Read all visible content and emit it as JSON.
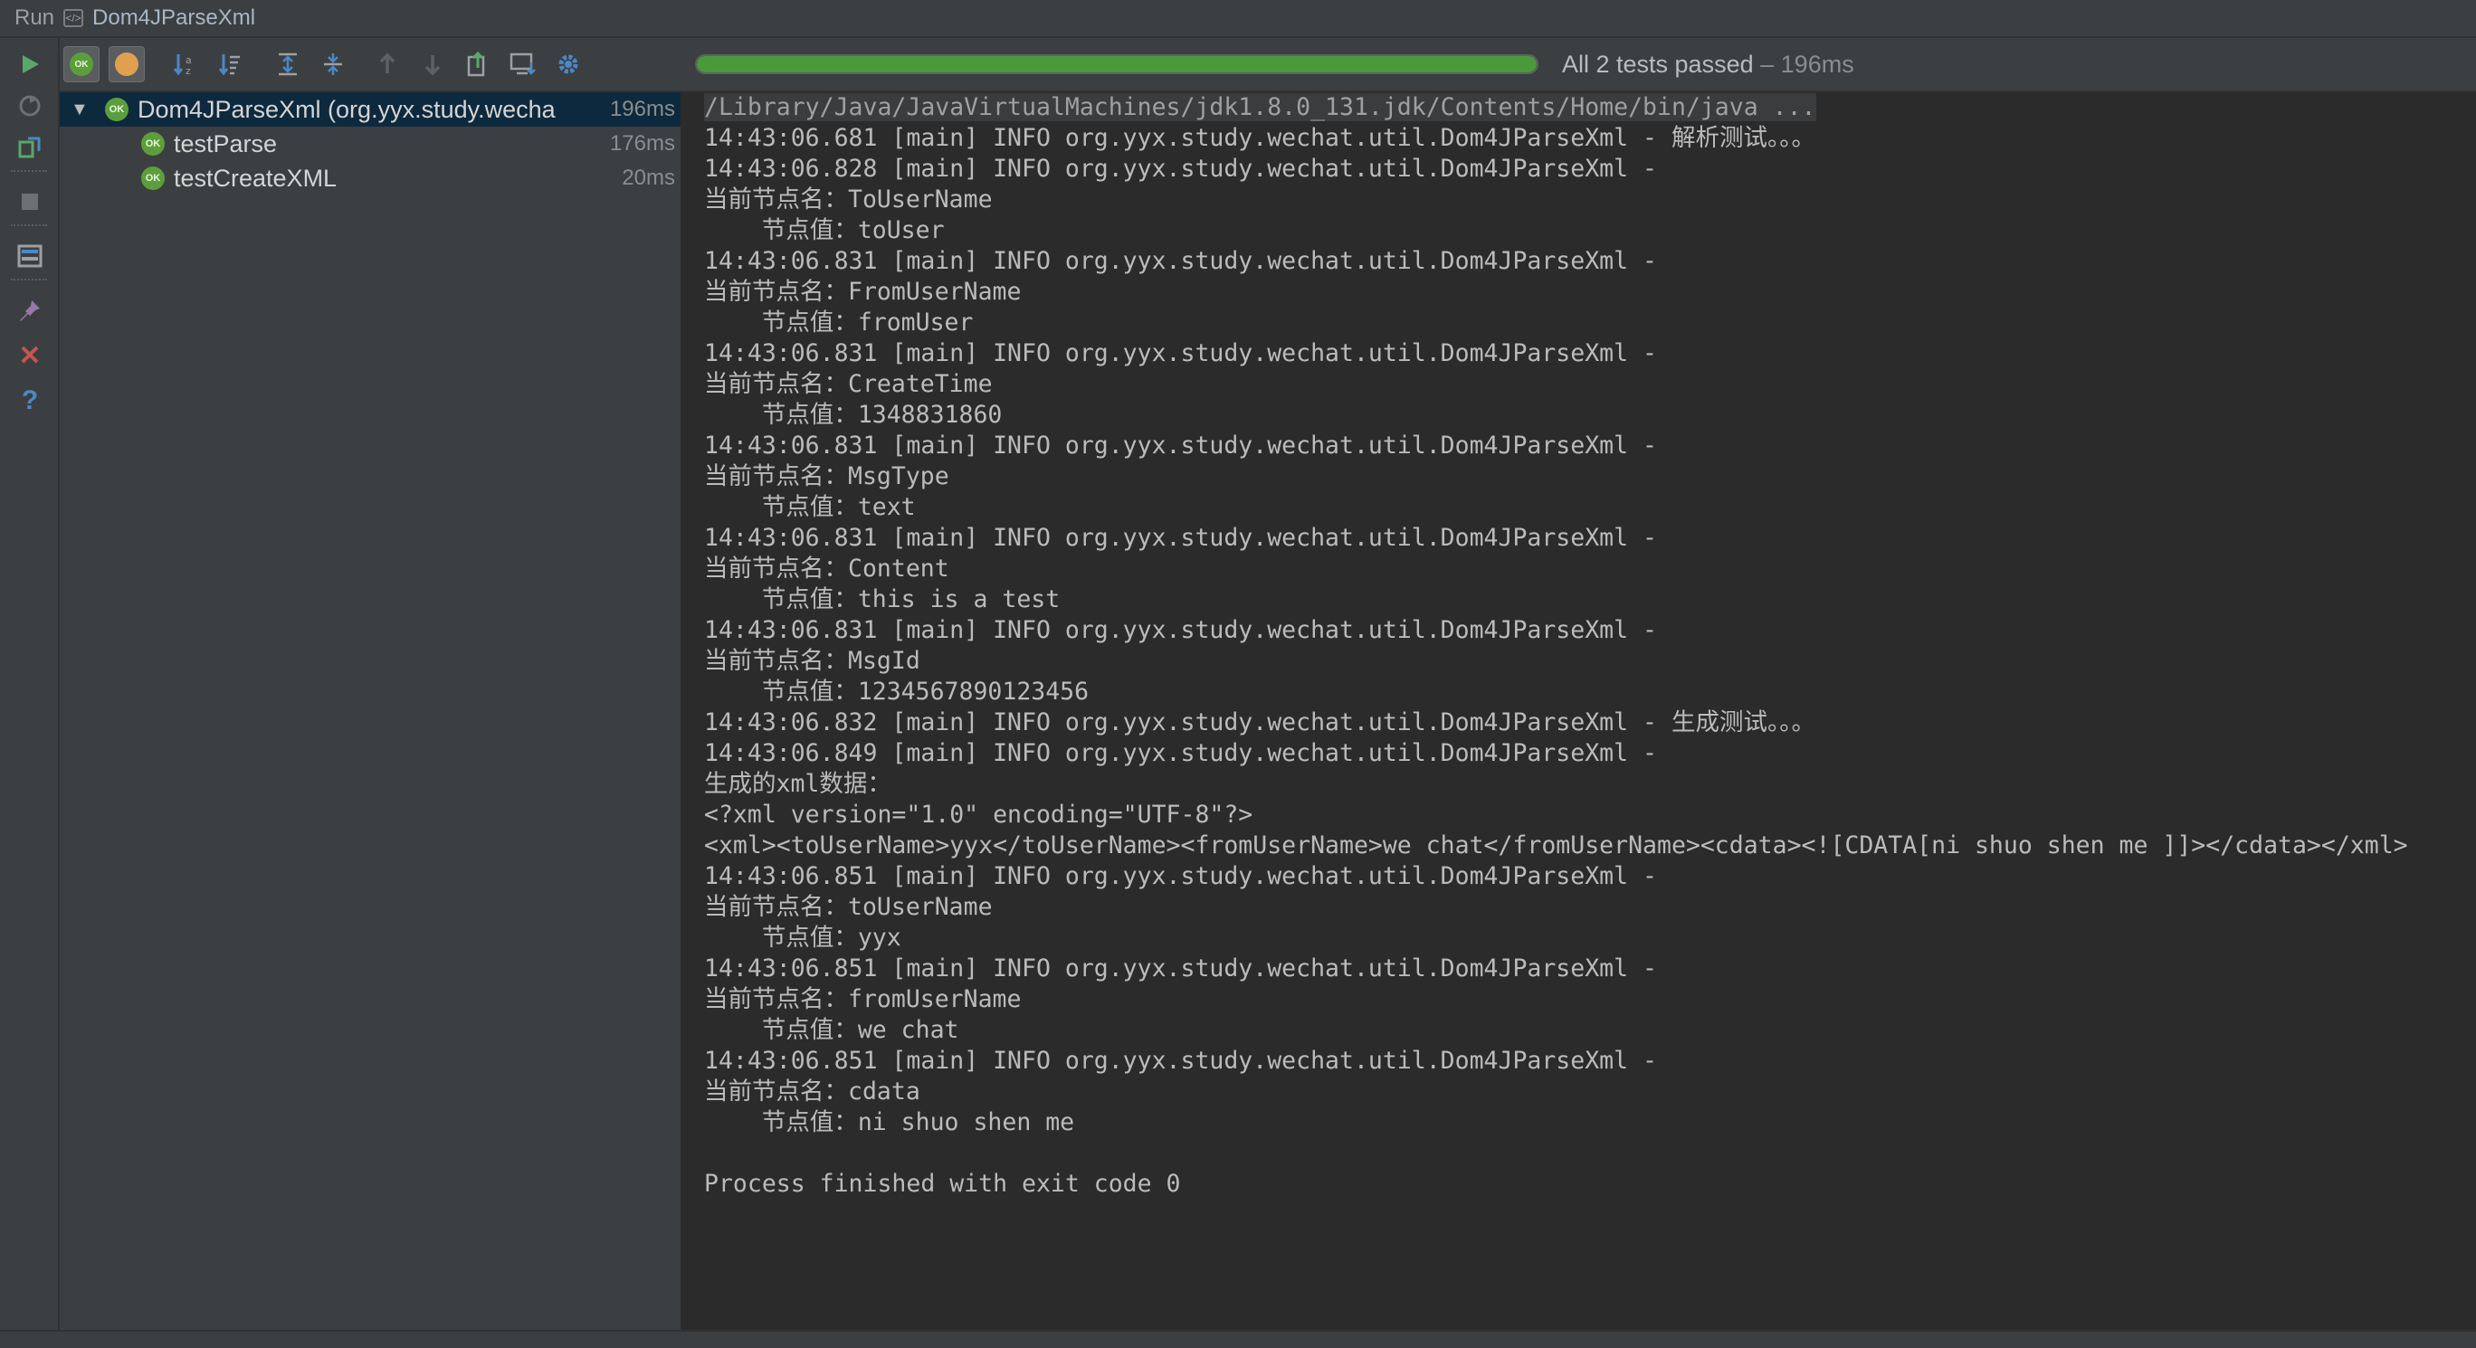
{
  "titlebar": {
    "prefix": "Run",
    "config_name": "Dom4JParseXml"
  },
  "toolbar": {
    "status_text": "All 2 tests passed",
    "status_duration": "– 196ms",
    "progress_fraction": 1.0,
    "colors": {
      "progress": "#4a9a3a",
      "passed": "#5c9f3a"
    }
  },
  "tree": {
    "root": {
      "label": "Dom4JParseXml (org.yyx.study.wecha",
      "time": "196ms",
      "badge": "OK"
    },
    "children": [
      {
        "label": "testParse",
        "time": "176ms",
        "badge": "OK"
      },
      {
        "label": "testCreateXML",
        "time": "20ms",
        "badge": "OK"
      }
    ]
  },
  "console": {
    "lines": [
      "/Library/Java/JavaVirtualMachines/jdk1.8.0_131.jdk/Contents/Home/bin/java ...",
      "14:43:06.681 [main] INFO org.yyx.study.wechat.util.Dom4JParseXml - 解析测试。。。",
      "14:43:06.828 [main] INFO org.yyx.study.wechat.util.Dom4JParseXml -",
      "当前节点名：ToUserName",
      "    节点值：toUser",
      "14:43:06.831 [main] INFO org.yyx.study.wechat.util.Dom4JParseXml -",
      "当前节点名：FromUserName",
      "    节点值：fromUser",
      "14:43:06.831 [main] INFO org.yyx.study.wechat.util.Dom4JParseXml -",
      "当前节点名：CreateTime",
      "    节点值：1348831860",
      "14:43:06.831 [main] INFO org.yyx.study.wechat.util.Dom4JParseXml -",
      "当前节点名：MsgType",
      "    节点值：text",
      "14:43:06.831 [main] INFO org.yyx.study.wechat.util.Dom4JParseXml -",
      "当前节点名：Content",
      "    节点值：this is a test",
      "14:43:06.831 [main] INFO org.yyx.study.wechat.util.Dom4JParseXml -",
      "当前节点名：MsgId",
      "    节点值：1234567890123456",
      "14:43:06.832 [main] INFO org.yyx.study.wechat.util.Dom4JParseXml - 生成测试。。。",
      "14:43:06.849 [main] INFO org.yyx.study.wechat.util.Dom4JParseXml -",
      "生成的xml数据：",
      "<?xml version=\"1.0\" encoding=\"UTF-8\"?>",
      "<xml><toUserName>yyx</toUserName><fromUserName>we chat</fromUserName><cdata><![CDATA[ni shuo shen me ]]></cdata></xml>",
      "14:43:06.851 [main] INFO org.yyx.study.wechat.util.Dom4JParseXml -",
      "当前节点名：toUserName",
      "    节点值：yyx",
      "14:43:06.851 [main] INFO org.yyx.study.wechat.util.Dom4JParseXml -",
      "当前节点名：fromUserName",
      "    节点值：we chat",
      "14:43:06.851 [main] INFO org.yyx.study.wechat.util.Dom4JParseXml -",
      "当前节点名：cdata",
      "    节点值：ni shuo shen me",
      "",
      "Process finished with exit code 0"
    ]
  }
}
